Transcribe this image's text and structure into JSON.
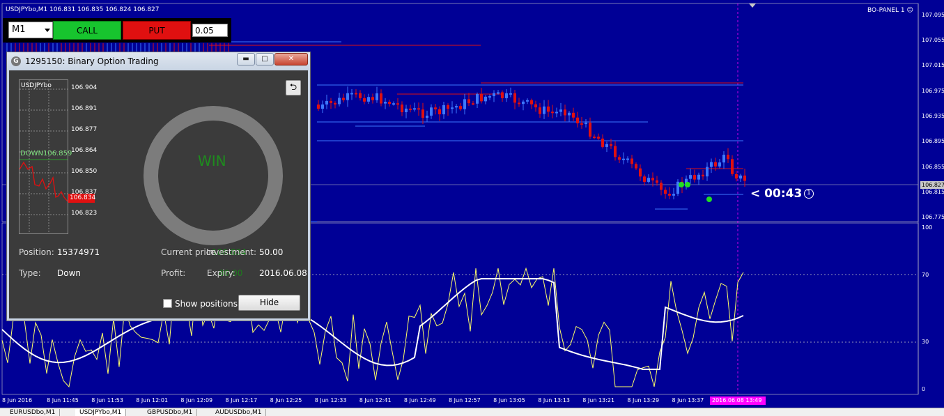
{
  "window": {
    "title": "USDJPYbo,M1  106.831 106.835 106.824 106.827",
    "panel_label": "BO-PANEL 1 ☺"
  },
  "trade_bar": {
    "timeframe": "M1",
    "call_label": "CALL",
    "put_label": "PUT",
    "amount": "0.05"
  },
  "price_axis": [
    "107.095",
    "107.055",
    "107.015",
    "106.975",
    "106.935",
    "106.895",
    "106.855",
    "106.815",
    "106.775"
  ],
  "current_price": "106.827",
  "indicator_axis": [
    "100",
    "70",
    "30",
    "0"
  ],
  "countdown": "< 00:43",
  "time_axis": [
    "8 Jun 2016",
    "8 Jun 11:45",
    "8 Jun 11:53",
    "8 Jun 12:01",
    "8 Jun 12:09",
    "8 Jun 12:17",
    "8 Jun 12:25",
    "8 Jun 12:33",
    "8 Jun 12:41",
    "8 Jun 12:49",
    "8 Jun 12:57",
    "8 Jun 13:05",
    "8 Jun 13:13",
    "8 Jun 13:21",
    "8 Jun 13:29",
    "8 Jun 13:37"
  ],
  "time_highlight": "2016.06.08 13:49",
  "dialog": {
    "title": "1295150: Binary Option Trading",
    "mini_symbol": "USDJPYbo",
    "mini_prices": [
      "106.904",
      "106.891",
      "106.877",
      "106.864",
      "106.850",
      "106.837",
      "106.823"
    ],
    "down_label": "DOWN",
    "down_value": "106.859",
    "mini_current": "106.834",
    "result": "WIN",
    "position_label": "Position:",
    "position_value": "15374971",
    "type_label": "Type:",
    "type_value": "Down",
    "current_price_label": "Current price",
    "current_price_ghost": "106.834",
    "investment_label": "Investment:",
    "investment_value": "50.00",
    "profit_label": "Profit:",
    "profit_ghost": "80.00",
    "expiry_label": "Expiry:",
    "expiry_value": "2016.06.08",
    "show_positions_label": "Show positions",
    "hide_label": "Hide",
    "min_glyph": "▬",
    "max_glyph": "□",
    "close_glyph": "✕",
    "back_glyph": "⮌"
  },
  "tabs": [
    "EURUSDbo,M1",
    "USDJPYbo,M1",
    "GBPUSDbo,M1",
    "AUDUSDbo,M1"
  ],
  "colors": {
    "background": "#000096",
    "bull_candle": "#3c78ff",
    "bear_candle": "#e01010",
    "call": "#17c42e",
    "put": "#e01010",
    "highlight": "#ff00ff"
  }
}
